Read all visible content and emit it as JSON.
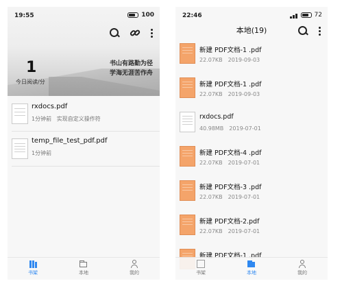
{
  "left_screen": {
    "status": {
      "time": "19:55",
      "battery": "100"
    },
    "hero": {
      "count": "1",
      "count_label": "今日阅读/分",
      "motto_line1": "书山有路勤为径",
      "motto_line2": "学海无涯苦作舟"
    },
    "books": [
      {
        "title": "rxdocs.pdf",
        "time": "1分钟前",
        "note": "实现自定义操作符"
      },
      {
        "title": "temp_file_test_pdf.pdf",
        "time": "1分钟前",
        "note": ""
      }
    ],
    "tabs": [
      {
        "label": "书架",
        "active": true
      },
      {
        "label": "本地",
        "active": false
      },
      {
        "label": "我的",
        "active": false
      }
    ]
  },
  "right_screen": {
    "status": {
      "time": "22:46",
      "battery": "72"
    },
    "title": "本地(19)",
    "files": [
      {
        "name": "新建 PDF文档-1 .pdf",
        "size": "22.07KB",
        "date": "2019-09-03",
        "thumb": "orange"
      },
      {
        "name": "新建 PDF文档-1 .pdf",
        "size": "22.07KB",
        "date": "2019-09-03",
        "thumb": "orange"
      },
      {
        "name": "rxdocs.pdf",
        "size": "40.98MB",
        "date": "2019-07-01",
        "thumb": "plain"
      },
      {
        "name": "新建 PDF文档-4 .pdf",
        "size": "22.07KB",
        "date": "2019-07-01",
        "thumb": "orange"
      },
      {
        "name": "新建 PDF文档-3 .pdf",
        "size": "22.07KB",
        "date": "2019-07-01",
        "thumb": "orange"
      },
      {
        "name": "新建 PDF文档-2.pdf",
        "size": "22.07KB",
        "date": "2019-07-01",
        "thumb": "orange"
      },
      {
        "name": "新建 PDF文档-1 .pdf",
        "size": "",
        "date": "",
        "thumb": "orange"
      }
    ],
    "tabs": [
      {
        "label": "书架",
        "active": false
      },
      {
        "label": "本地",
        "active": true
      },
      {
        "label": "我的",
        "active": false
      }
    ]
  },
  "colors": {
    "accent": "#2f88f0",
    "pdf_thumb": "#f4a46a",
    "background": "#f7f7f7"
  }
}
